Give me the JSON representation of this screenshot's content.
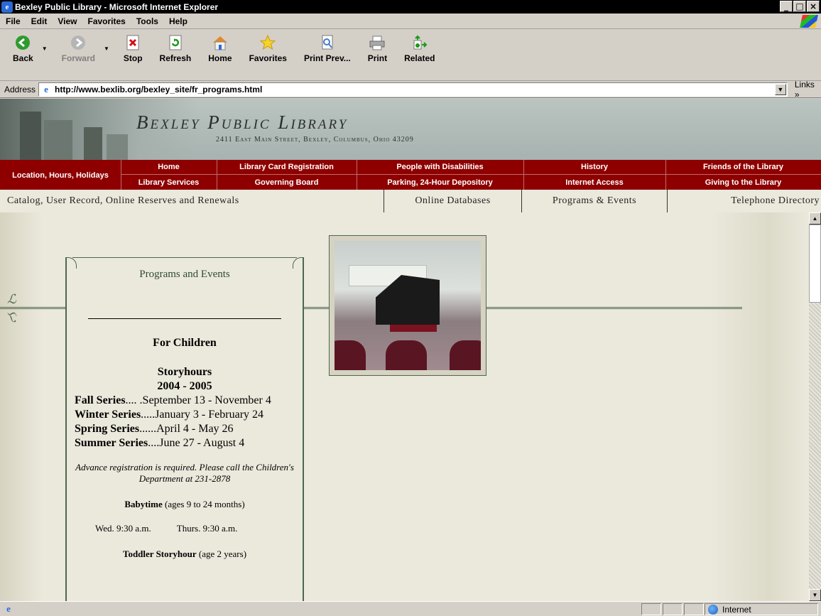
{
  "window": {
    "title": "Bexley Public Library - Microsoft Internet Explorer",
    "controls": [
      "_",
      "□",
      "×"
    ]
  },
  "menu": [
    "File",
    "Edit",
    "View",
    "Favorites",
    "Tools",
    "Help"
  ],
  "toolbar": {
    "back": "Back",
    "forward": "Forward",
    "stop": "Stop",
    "refresh": "Refresh",
    "home": "Home",
    "favorites": "Favorites",
    "print_preview": "Print Prev...",
    "print": "Print",
    "related": "Related"
  },
  "address": {
    "label": "Address",
    "url": "http://www.bexlib.org/bexley_site/fr_programs.html",
    "links": "Links"
  },
  "banner": {
    "name": "Bexley Public Library",
    "address": "2411 East Main Street, Bexley, Columbus, Ohio 43209"
  },
  "nav": {
    "location": "Location, Hours, Holidays",
    "home": "Home",
    "library_services": "Library Services",
    "card_registration": "Library Card Registration",
    "governing_board": "Governing Board",
    "disabilities": "People with Disabilities",
    "parking": "Parking, 24-Hour Depository",
    "history": "History",
    "internet_access": "Internet Access",
    "friends": "Friends of the Library",
    "giving": "Giving to the Library"
  },
  "tabs": {
    "catalog": "Catalog, User Record, Online Reserves and Renewals",
    "databases": "Online Databases",
    "programs": "Programs & Events",
    "directory": "Telephone Directory"
  },
  "panel": {
    "title": "Programs and Events",
    "section": "For Children",
    "subhead1": "Storyhours",
    "subhead2": "2004 - 2005",
    "series": [
      {
        "name": "Fall Series",
        "dates": ".... .September 13 - November 4"
      },
      {
        "name": "Winter Series",
        "dates": ".....January 3 - February 24"
      },
      {
        "name": "Spring Series",
        "dates": "......April 4 - May 26"
      },
      {
        "name": "Summer Series",
        "dates": "....June 27 - August 4"
      }
    ],
    "note": "Advance registration is required. Please call the Children's Department at 231-2878",
    "babytime_name": "Babytime",
    "babytime_ages": " (ages 9 to 24 months)",
    "babytime_wed": "Wed. 9:30 a.m.",
    "babytime_thurs": "Thurs. 9:30 a.m.",
    "toddler_name": "Toddler Storyhour",
    "toddler_ages": " (age 2 years)"
  },
  "status": {
    "zone": "Internet"
  }
}
